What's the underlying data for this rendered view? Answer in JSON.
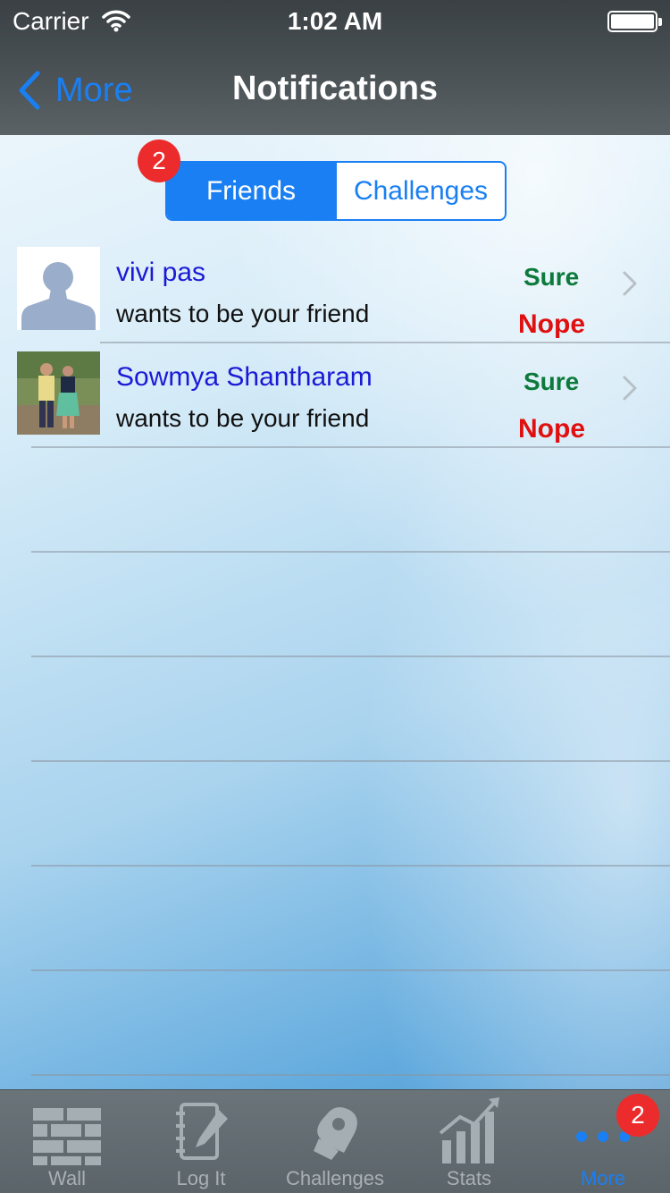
{
  "status_bar": {
    "carrier": "Carrier",
    "time": "1:02 AM"
  },
  "nav": {
    "back_label": "More",
    "title": "Notifications"
  },
  "segments": {
    "friends": "Friends",
    "challenges": "Challenges",
    "friends_badge": "2",
    "selected": "Friends"
  },
  "notifications": [
    {
      "name": "vivi pas",
      "message": "wants to be your friend",
      "accept": "Sure",
      "decline": "Nope"
    },
    {
      "name": "Sowmya Shantharam",
      "message": "wants to be your friend",
      "accept": "Sure",
      "decline": "Nope"
    }
  ],
  "tabs": [
    {
      "label": "Wall",
      "icon": "brick-wall-icon"
    },
    {
      "label": "Log It",
      "icon": "notebook-pencil-icon"
    },
    {
      "label": "Challenges",
      "icon": "boxing-glove-icon"
    },
    {
      "label": "Stats",
      "icon": "bar-chart-icon"
    },
    {
      "label": "More",
      "icon": "more-dots-icon"
    }
  ],
  "more_tab_badge": "2",
  "colors": {
    "accent": "#1a7ff2",
    "accept": "#0d7a3c",
    "decline": "#e01010",
    "badge": "#ec2c2c",
    "name": "#1a1ad6"
  }
}
